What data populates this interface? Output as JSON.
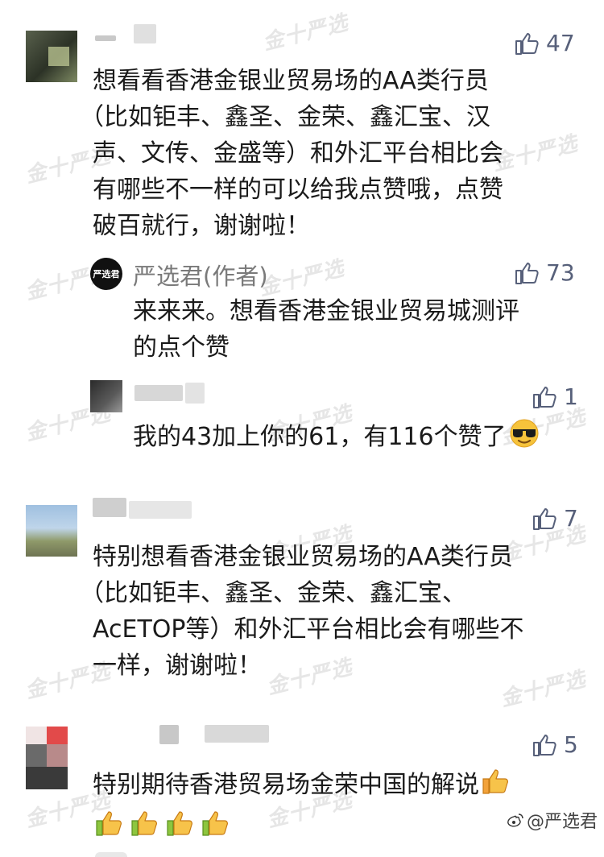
{
  "watermark": "金十严选",
  "comments": [
    {
      "likes": "47",
      "text_lines": [
        "想看看香港金银业贸易场的AA类行员",
        "（比如钜丰、鑫圣、金荣、鑫汇宝、汉",
        "声、文传、金盛等）和外汇平台相比会",
        "有哪些不一样的可以给我点赞哦，点赞",
        "破百就行，谢谢啦！"
      ]
    },
    {
      "author": "严选君(作者)",
      "avatar_text": "严选君",
      "likes": "73",
      "text_lines": [
        "来来来。想看香港金银业贸易城测评",
        "的点个赞"
      ]
    },
    {
      "likes": "1",
      "text": "我的43加上你的61，有116个赞了",
      "emoji": "sunglasses-face"
    },
    {
      "likes": "7",
      "text_lines": [
        "特别想看香港金银业贸易场的AA类行员",
        "（比如钜丰、鑫圣、金荣、鑫汇宝、",
        "AcETOP等）和外汇平台相比会有哪些不",
        "一样，谢谢啦！"
      ]
    },
    {
      "likes": "5",
      "text": "特别期待香港贸易场金荣中国的解说",
      "emoji": "thumbs-up"
    }
  ],
  "credit": "@严选君",
  "colors": {
    "like_icon": "#57607a",
    "author": "#7a7a7a",
    "text": "#1b1b1b"
  }
}
